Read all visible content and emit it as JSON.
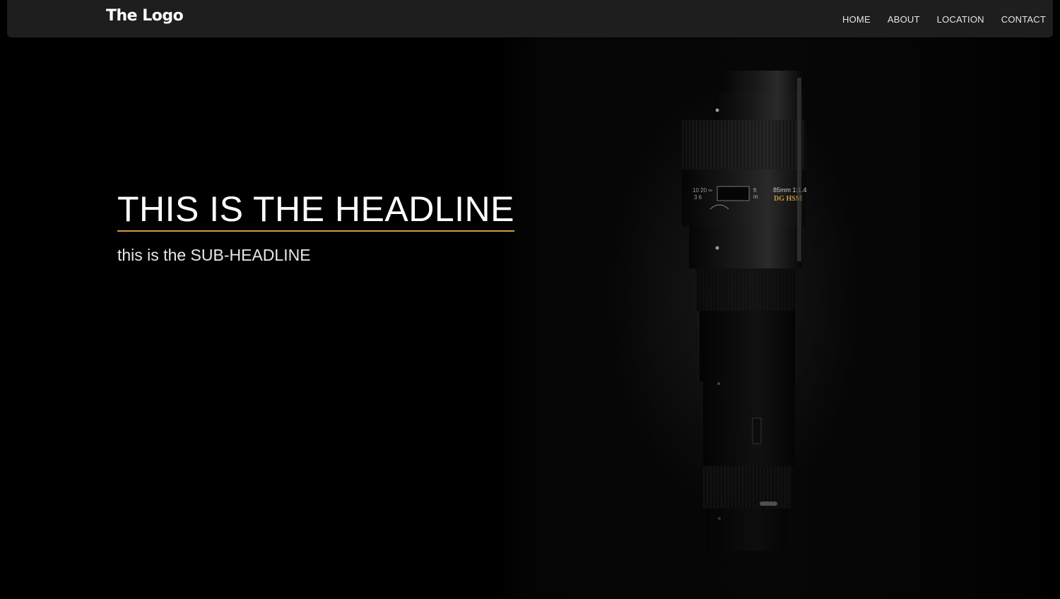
{
  "header": {
    "logo": "The Logo",
    "nav": [
      "HOME",
      "ABOUT",
      "LOCATION",
      "CONTACT"
    ]
  },
  "hero": {
    "headline": "THIS IS THE HEADLINE",
    "subheadline": "this is the SUB-HEADLINE",
    "accent_color": "#d79a4a",
    "lens_text": {
      "focal": "85mm 1:1.4",
      "brand": "DG HSM",
      "scale_1": "10 20 ∞",
      "scale_2": "3 6",
      "unit_1": "ft",
      "unit_2": "m"
    }
  }
}
